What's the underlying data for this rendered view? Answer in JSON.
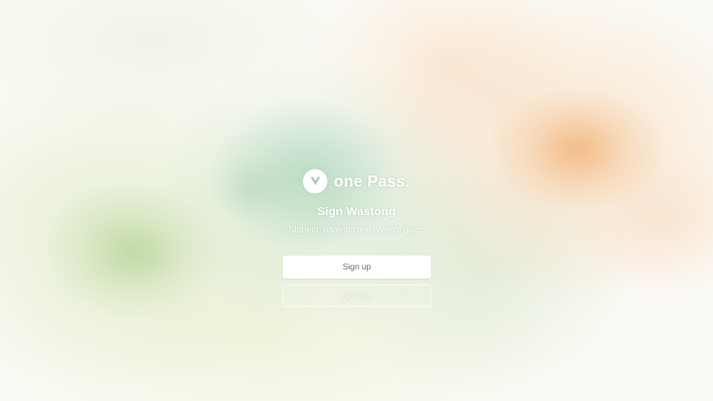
{
  "brand": {
    "logo_icon": "check-shield-icon",
    "name": "one Pass."
  },
  "heading": {
    "title": "Sign Wastong",
    "subtitle": "Student, parentts test, Wecre guice"
  },
  "actions": {
    "primary_label": "Sign up",
    "secondary_label": "Sign Up"
  },
  "colors": {
    "text": "#ffffff",
    "primary_button_bg": "#ffffff",
    "primary_button_text": "#6b6b6b",
    "background_green": "#bedebe",
    "background_orange": "#f2b476"
  }
}
